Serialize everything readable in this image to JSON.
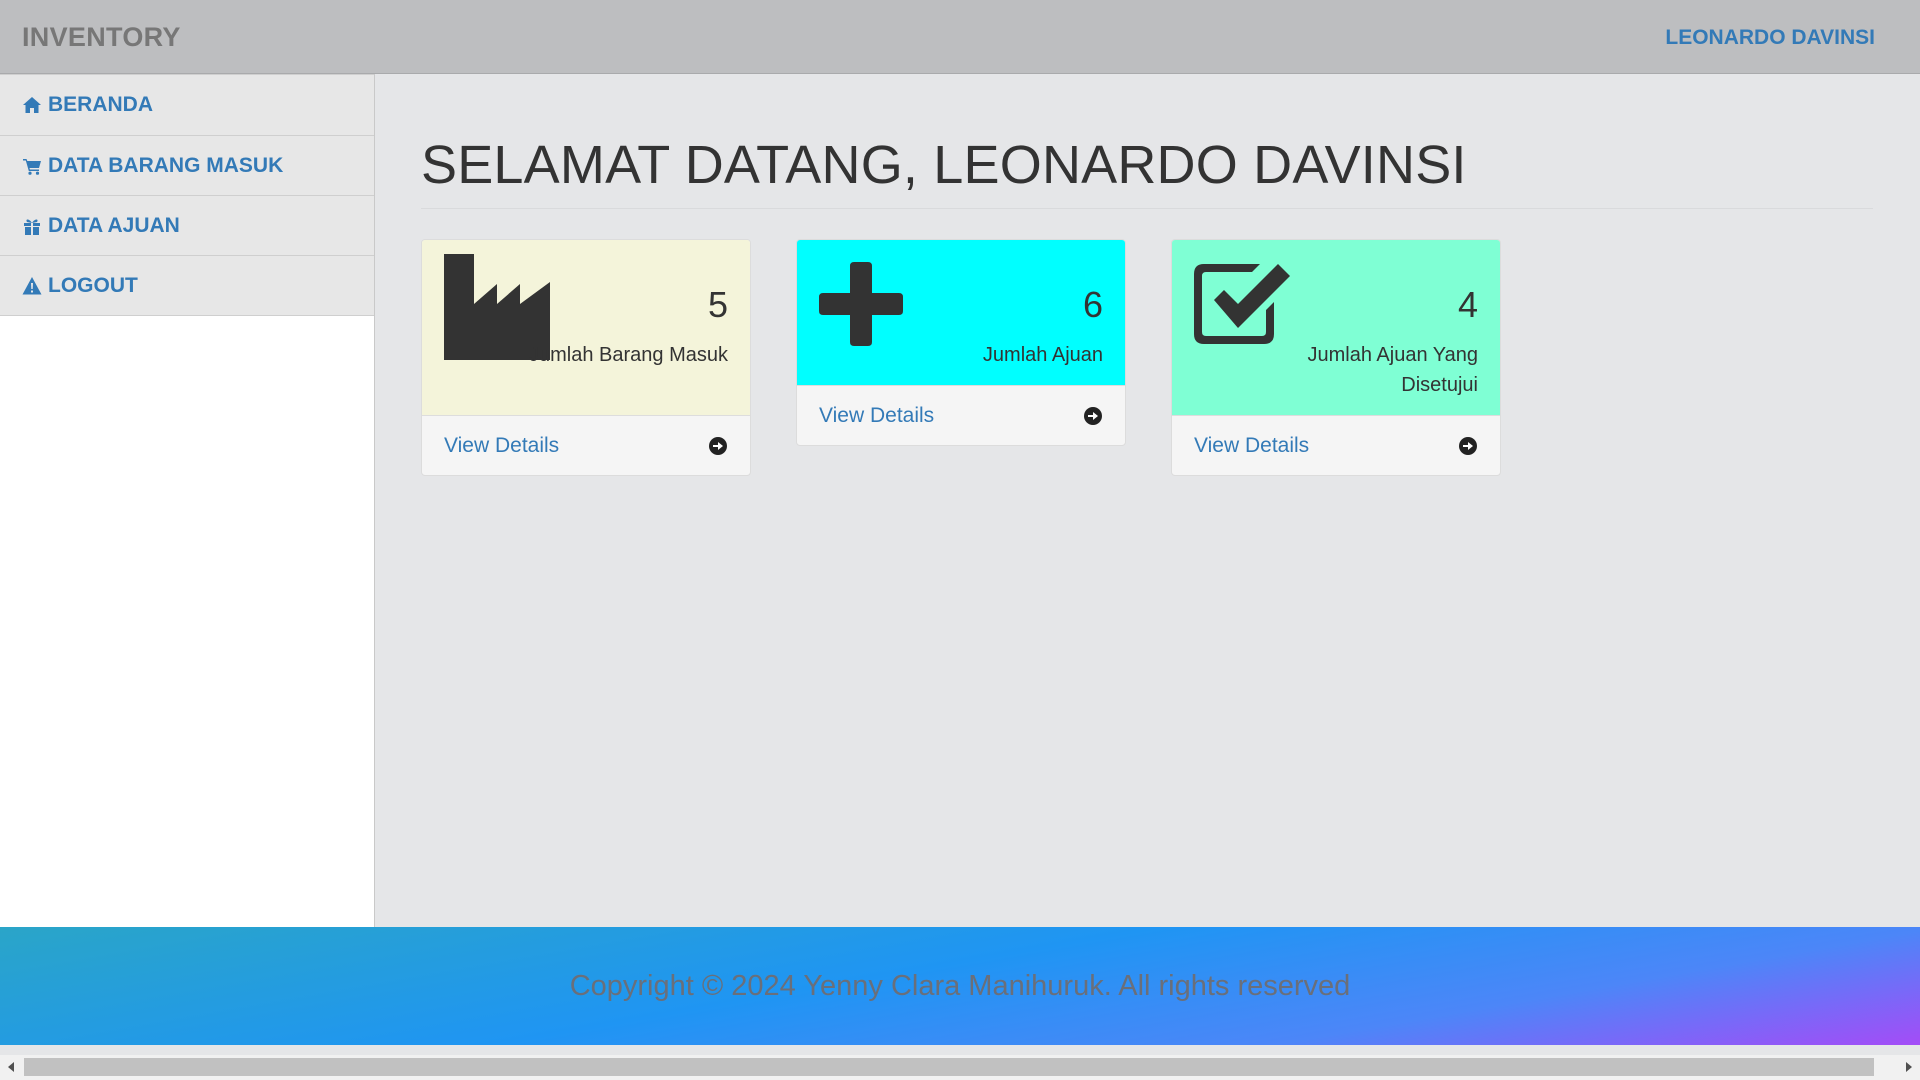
{
  "header": {
    "brand": "INVENTORY",
    "user": "LEONARDO DAVINSI"
  },
  "sidebar": {
    "items": [
      {
        "label": "BERANDA",
        "icon": "home-icon"
      },
      {
        "label": "DATA BARANG MASUK",
        "icon": "cart-icon"
      },
      {
        "label": "DATA AJUAN",
        "icon": "gift-icon"
      },
      {
        "label": "LOGOUT",
        "icon": "warning-icon"
      }
    ]
  },
  "main": {
    "title": "SELAMAT DATANG, LEONARDO DAVINSI",
    "cards": [
      {
        "icon": "industry-icon",
        "value": "5",
        "label": "Jumlah Barang Masuk",
        "link": "View Details",
        "color": "#f4f4da"
      },
      {
        "icon": "plus-icon",
        "value": "6",
        "label": "Jumlah Ajuan",
        "link": "View Details",
        "color": "#00ffff"
      },
      {
        "icon": "check-square-icon",
        "value": "4",
        "label": "Jumlah Ajuan Yang Disetujui",
        "link": "View Details",
        "color": "#7fffd4"
      }
    ]
  },
  "footer": {
    "text": "Copyright © 2024 Yenny Clara Manihuruk. All rights reserved"
  }
}
